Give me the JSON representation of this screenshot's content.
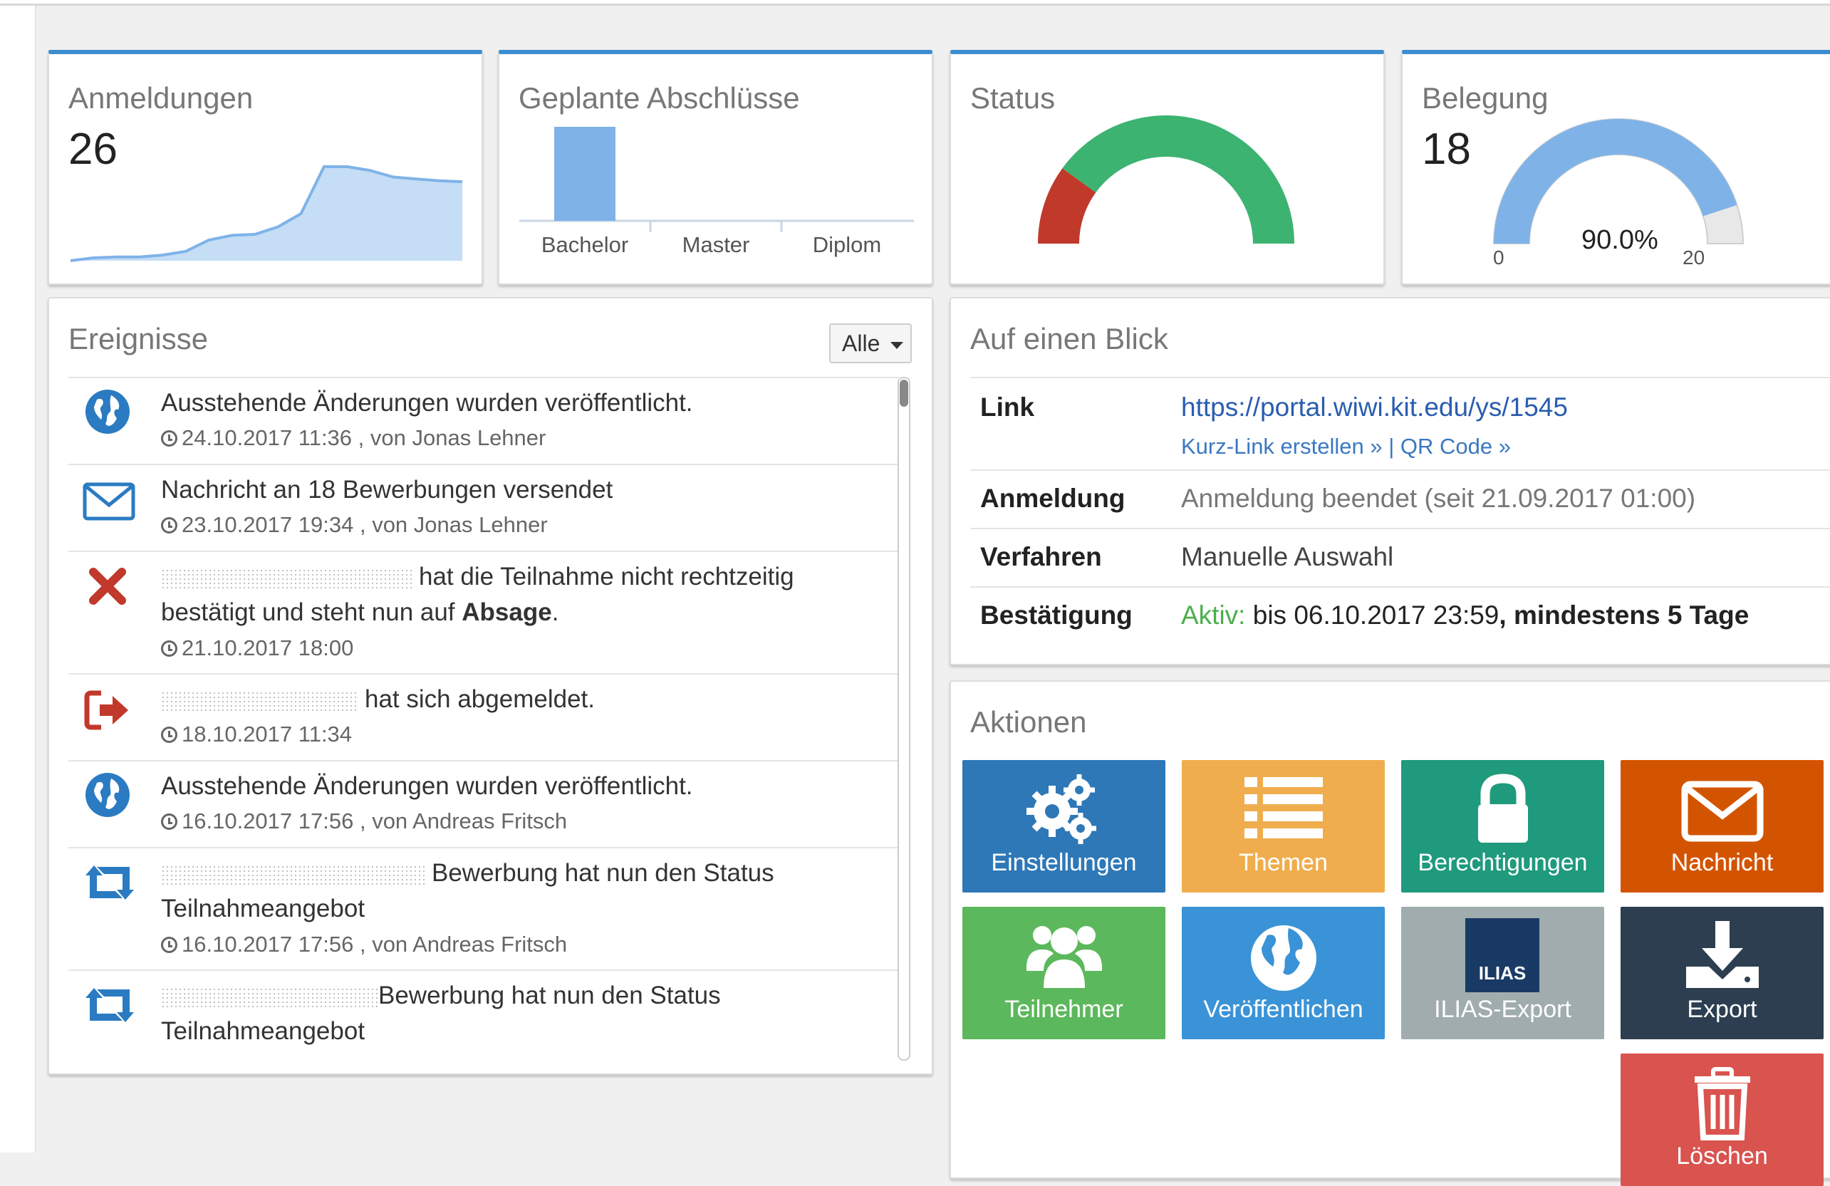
{
  "stats": {
    "registrations": {
      "title": "Anmeldungen",
      "count": "26",
      "sparkline": [
        0,
        3,
        4,
        4,
        6,
        10,
        22,
        27,
        28,
        36,
        50,
        100,
        100,
        96,
        89,
        87,
        85,
        84
      ]
    },
    "planned_degrees": {
      "title": "Geplante Abschlüsse",
      "chart_data": {
        "type": "bar",
        "categories": [
          "Bachelor",
          "Master",
          "Diplom"
        ],
        "values": [
          1,
          0,
          0
        ]
      }
    },
    "status": {
      "title": "Status",
      "gauge": {
        "red_fraction": 0.2,
        "red_color": "#c0392b",
        "green_color": "#3cb371"
      }
    },
    "occupancy": {
      "title": "Belegung",
      "count": "18",
      "percent": "90.0%",
      "min": "0",
      "max": "20",
      "fraction": 0.9,
      "fill_color": "#7fb3e8"
    }
  },
  "events": {
    "title": "Ereignisse",
    "filter_label": "Alle",
    "items": [
      {
        "icon": "globe-icon",
        "text": "Ausstehende Änderungen wurden veröffentlicht.",
        "time": "24.10.2017 11:36",
        "by": ", von Jonas Lehner"
      },
      {
        "icon": "envelope-icon",
        "text": "Nachricht an 18 Bewerbungen versendet",
        "time": "23.10.2017 19:34",
        "by": ", von Jonas Lehner"
      },
      {
        "icon": "times-icon",
        "text_a": "hat die Teilnahme nicht rechtzeitig",
        "text_b": "bestätigt und steht nun auf",
        "text_bold": "Absage",
        "text_end": ".",
        "time": "21.10.2017 18:00"
      },
      {
        "icon": "sign-out-icon",
        "text": "hat sich abgemeldet.",
        "time": "18.10.2017 11:34"
      },
      {
        "icon": "globe-icon",
        "text": "Ausstehende Änderungen wurden veröffentlicht.",
        "time": "16.10.2017 17:56",
        "by": ", von Andreas Fritsch"
      },
      {
        "icon": "retweet-icon",
        "text_a": "Bewerbung hat nun den Status",
        "text_b": "Teilnahmeangebot",
        "time": "16.10.2017 17:56",
        "by": ", von Andreas Fritsch"
      },
      {
        "icon": "retweet-icon",
        "text_a": "Bewerbung hat nun den Status",
        "text_b": "Teilnahmeangebot"
      }
    ]
  },
  "glance": {
    "title": "Auf einen Blick",
    "rows": {
      "link_label": "Link",
      "link_url": "https://portal.wiwi.kit.edu/ys/1545",
      "short_link": "Kurz-Link erstellen »",
      "sep": "|",
      "qr_code": "QR Code »",
      "registration_label": "Anmeldung",
      "registration_value": "Anmeldung beendet (seit 21.09.2017 01:00)",
      "procedure_label": "Verfahren",
      "procedure_value": "Manuelle Auswahl",
      "confirmation_label": "Bestätigung",
      "confirmation_active": "Aktiv:",
      "confirmation_until": "bis 06.10.2017 23:59",
      "confirmation_min": ", mindestens 5 Tage"
    }
  },
  "actions": {
    "title": "Aktionen",
    "tiles": [
      {
        "label": "Einstellungen",
        "icon": "cogs-icon",
        "color": "#2e78b7"
      },
      {
        "label": "Themen",
        "icon": "list-icon",
        "color": "#efad4d"
      },
      {
        "label": "Berechtigungen",
        "icon": "lock-icon",
        "color": "#1f9a7c"
      },
      {
        "label": "Nachricht",
        "icon": "envelope-icon",
        "color": "#d35400"
      },
      {
        "label": "Teilnehmer",
        "icon": "users-icon",
        "color": "#5cb85c"
      },
      {
        "label": "Veröffentlichen",
        "icon": "globe-icon",
        "color": "#3a93d6"
      },
      {
        "label": "ILIAS-Export",
        "icon": "ilias-icon",
        "icon_text": "ILIAS",
        "color": "#a0acae"
      },
      {
        "label": "Export",
        "icon": "download-icon",
        "color": "#2c3e50"
      },
      {
        "label": "Löschen",
        "icon": "trash-icon",
        "color": "#d9534f"
      }
    ]
  }
}
